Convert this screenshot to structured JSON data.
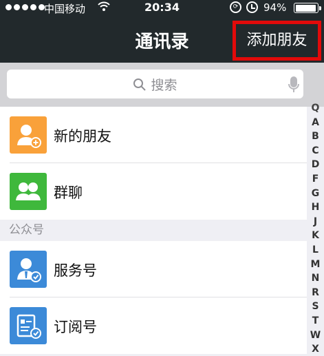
{
  "status_bar": {
    "carrier": "中国移动",
    "time": "20:34",
    "battery": "94%",
    "battery_level": 0.94
  },
  "nav": {
    "title": "通讯录",
    "add_friend_label": "添加朋友"
  },
  "search": {
    "placeholder": "搜索"
  },
  "list": {
    "new_friends": "新的朋友",
    "group_chat": "群聊",
    "section_official": "公众号",
    "service_account": "服务号",
    "subscription_account": "订阅号"
  },
  "index_letters": [
    "Q",
    "A",
    "B",
    "C",
    "D",
    "F",
    "G",
    "H",
    "J",
    "K",
    "L",
    "M",
    "N",
    "R",
    "S",
    "T",
    "W",
    "X"
  ],
  "colors": {
    "nav_bg": "#22292c",
    "new_friends_icon": "#f9a13a",
    "group_icon": "#3fb83c",
    "service_icon": "#3c8ad8",
    "subscription_icon": "#3c8ad8",
    "highlight_border": "#e20a0a"
  }
}
